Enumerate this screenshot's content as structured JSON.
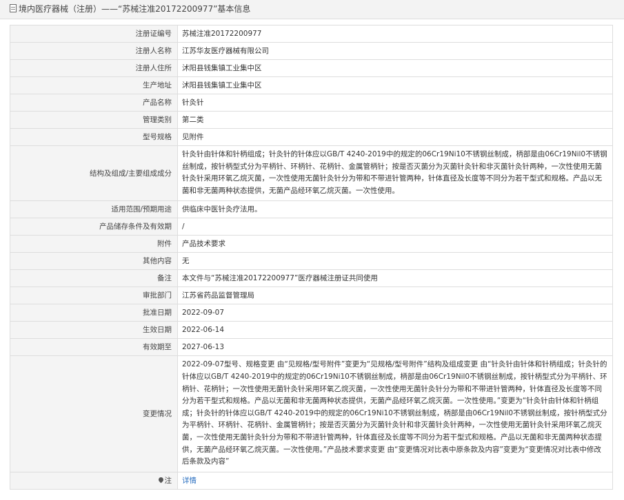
{
  "header": {
    "title": "境内医疗器械（注册）——“苏械注准20172200977”基本信息"
  },
  "fields": [
    {
      "label": "注册证编号",
      "value": "苏械注准20172200977"
    },
    {
      "label": "注册人名称",
      "value": "江苏华友医疗器械有限公司"
    },
    {
      "label": "注册人住所",
      "value": "沭阳县钱集镇工业集中区"
    },
    {
      "label": "生产地址",
      "value": "沭阳县钱集镇工业集中区"
    },
    {
      "label": "产品名称",
      "value": "针灸针"
    },
    {
      "label": "管理类别",
      "value": "第二类"
    },
    {
      "label": "型号规格",
      "value": "见附件"
    },
    {
      "label": "结构及组成/主要组成成分",
      "value": "针灸针由针体和针柄组成；针灸针的针体应以GB/T 4240-2019中的规定的06Cr19Ni10不锈钢丝制成，柄部是由06Cr19Nil0不锈钢丝制成，按针柄型式分为平柄针、环柄针、花柄针、金属管柄针；按是否灭菌分为灭菌针灸针和非灭菌针灸针两种，一次性使用无菌针灸针采用环氧乙烷灭菌，一次性使用无菌针灸针分为带和不带进针管两种，针体直径及长度等不同分为若干型式和规格。产品以无菌和非无菌两种状态提供，无菌产品经环氧乙烷灭菌。一次性使用。"
    },
    {
      "label": "适用范围/预期用途",
      "value": "供临床中医针灸疗法用。"
    },
    {
      "label": "产品储存条件及有效期",
      "value": "/"
    },
    {
      "label": "附件",
      "value": "产品技术要求"
    },
    {
      "label": "其他内容",
      "value": "无"
    },
    {
      "label": "备注",
      "value": "本文件与“苏械注准20172200977”医疗器械注册证共同使用"
    },
    {
      "label": "审批部门",
      "value": "江苏省药品监督管理局"
    },
    {
      "label": "批准日期",
      "value": "2022-09-07"
    },
    {
      "label": "生效日期",
      "value": "2022-06-14"
    },
    {
      "label": "有效期至",
      "value": "2027-06-13"
    },
    {
      "label": "变更情况",
      "value": "2022-09-07型号、规格变更 由“见规格/型号附件”变更为“见规格/型号附件”结构及组成变更 由“针灸针由针体和针柄组成；针灸针的针体应以GB/T 4240-2019中的规定的06Cr19Ni10不锈钢丝制成，柄部是由06Cr19Nil0不锈钢丝制成，按针柄型式分为平柄针、环柄针、花柄针；一次性使用无菌针灸针采用环氧乙烷灭菌，一次性使用无菌针灸针分为带和不带进针管两种，针体直径及长度等不同分为若干型式和规格。产品以无菌和非无菌两种状态提供，无菌产品经环氧乙烷灭菌。一次性使用。”变更为“针灸针由针体和针柄组成；针灸针的针体应以GB/T 4240-2019中的规定的06Cr19Ni10不锈钢丝制成，柄部是由06Cr19Nil0不锈钢丝制成，按针柄型式分为平柄针、环柄针、花柄针、金属管柄针；按是否灭菌分为灭菌针灸针和非灭菌针灸针两种，一次性使用无菌针灸针采用环氧乙烷灭菌，一次性使用无菌针灸针分为带和不带进针管两种，针体直径及长度等不同分为若干型式和规格。产品以无菌和非无菌两种状态提供，无菌产品经环氧乙烷灭菌。一次性使用。”产品技术要求变更 由“变更情况对比表中原条款及内容”变更为“变更情况对比表中修改后条款及内容”"
    }
  ],
  "note": {
    "label": "注",
    "link_text": "详情"
  }
}
